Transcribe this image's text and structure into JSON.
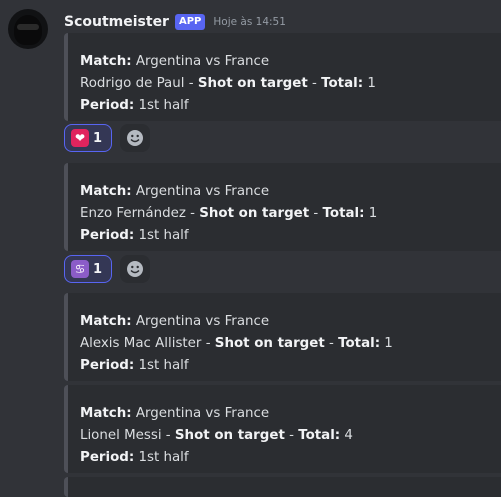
{
  "message": {
    "username": "Scoutmeister",
    "badge": "APP",
    "timestamp": "Hoje às 14:51"
  },
  "embeds": [
    {
      "match_label": "Match:",
      "match": " Argentina vs France",
      "player": "Rodrigo de Paul",
      "sep1": " - ",
      "event": "Shot on target",
      "sep2": " - ",
      "total_label": "Total:",
      "total": " 1",
      "period_label": "Period:",
      "period": " 1st half"
    },
    {
      "match_label": "Match:",
      "match": " Argentina vs France",
      "player": "Enzo Fernández",
      "sep1": " - ",
      "event": "Shot on target",
      "sep2": " - ",
      "total_label": "Total:",
      "total": " 1",
      "period_label": "Period:",
      "period": " 1st half"
    },
    {
      "match_label": "Match:",
      "match": " Argentina vs France",
      "player": "Alexis Mac Allister",
      "sep1": " - ",
      "event": "Shot on target",
      "sep2": " - ",
      "total_label": "Total:",
      "total": " 1",
      "period_label": "Period:",
      "period": " 1st half"
    },
    {
      "match_label": "Match:",
      "match": " Argentina vs France",
      "player": "Lionel Messi",
      "sep1": " - ",
      "event": "Shot on target",
      "sep2": " - ",
      "total_label": "Total:",
      "total": " 4",
      "period_label": "Period:",
      "period": " 1st half"
    }
  ],
  "reactions": [
    {
      "emoji": "sparkling-heart-icon",
      "count": "1",
      "color": "#e0245e"
    },
    {
      "emoji": "cancer-zodiac-icon",
      "count": "1",
      "color": "#8b5cc8"
    }
  ],
  "colors": {
    "accent": "#5865f2",
    "background": "#313338",
    "embed": "#2b2d31"
  }
}
